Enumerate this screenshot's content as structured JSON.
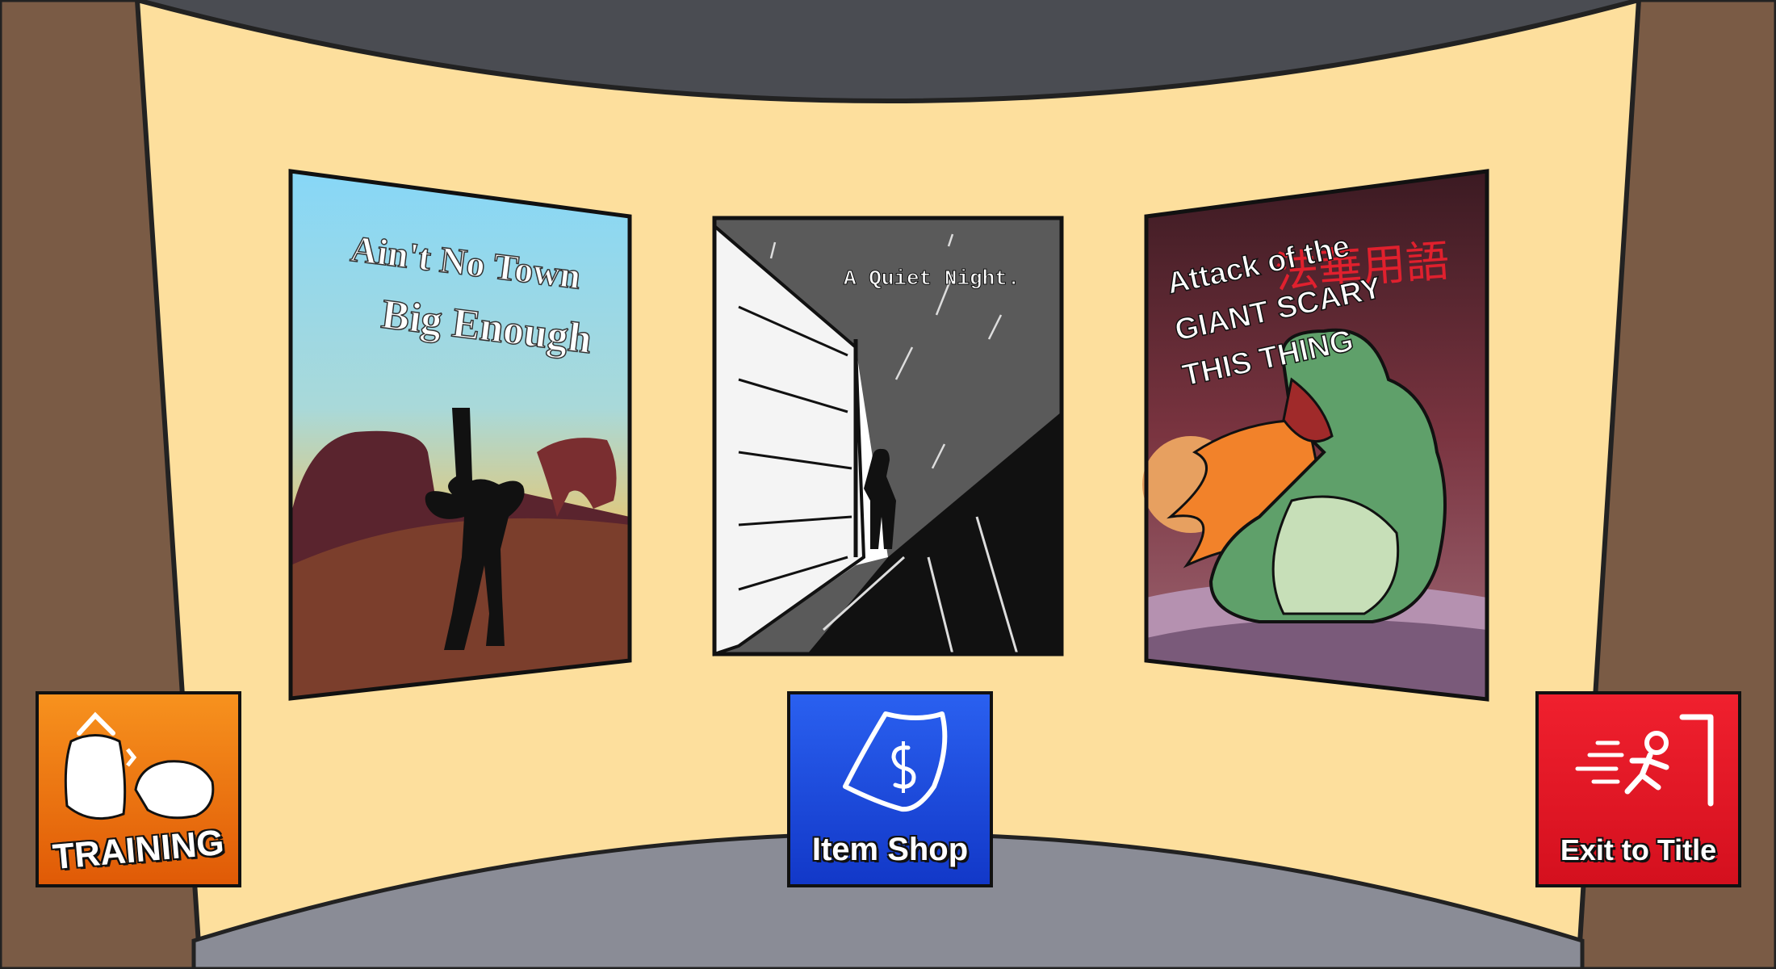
{
  "colors": {
    "backdrop": "#4a4c52",
    "wall": "#fddf9d",
    "pillar": "#7a5b45",
    "floor": "#8a8c96",
    "training": "#f07a10",
    "item_shop": "#1f4fe0",
    "exit": "#e41a2a"
  },
  "posters": [
    {
      "id": "western",
      "title_line1": "Ain't No Town",
      "title_line2": "Big Enough"
    },
    {
      "id": "noir",
      "title": "A Quiet Night."
    },
    {
      "id": "kaiju",
      "title_line1": "Attack of the",
      "title_line2": "GIANT SCARY",
      "title_line3": "THIS THING",
      "red_overlay": "法華用語"
    }
  ],
  "buttons": {
    "training": {
      "label": "TRAINING",
      "icon": "punching-bag-glove-icon"
    },
    "item_shop": {
      "label": "Item Shop",
      "icon": "money-bag-icon"
    },
    "exit": {
      "label": "Exit to Title",
      "icon": "running-exit-icon"
    }
  }
}
